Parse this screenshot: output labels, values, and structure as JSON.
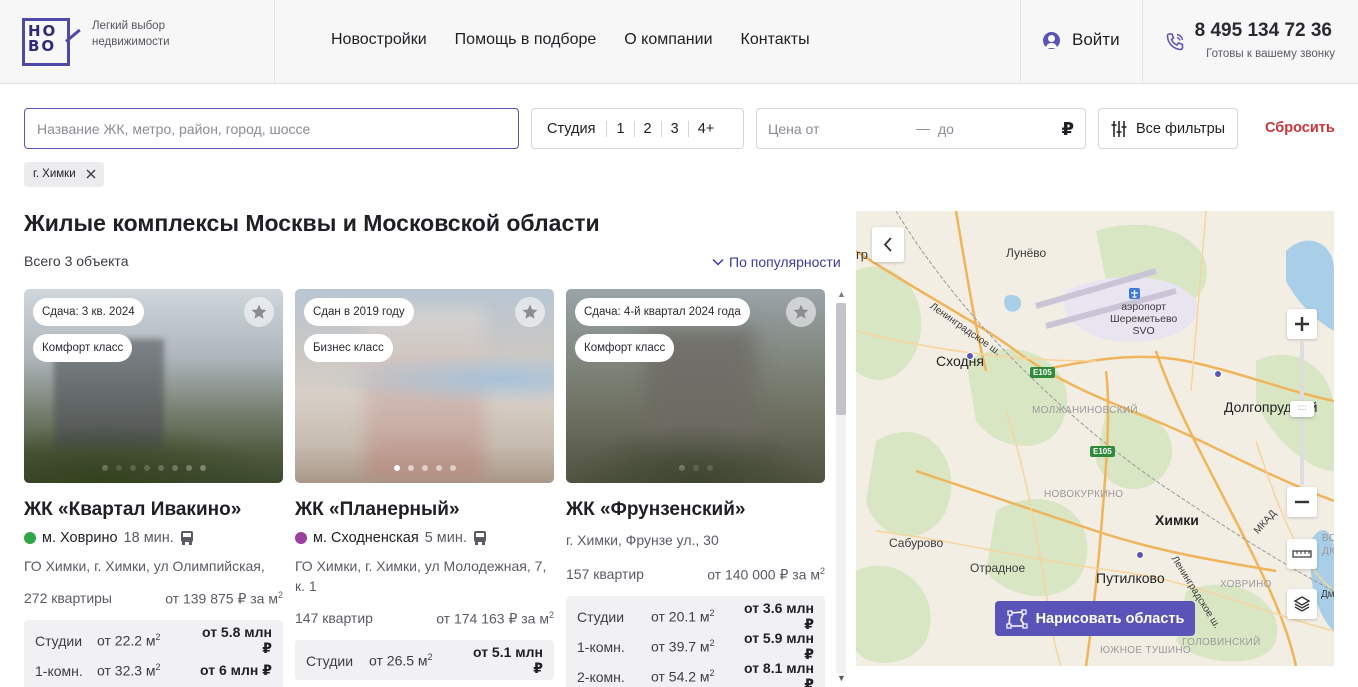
{
  "logo": {
    "text": "HO\nBO"
  },
  "header": {
    "tagline": "Легкий выбор недвижимости",
    "nav": [
      "Новостройки",
      "Помощь в подборе",
      "О компании",
      "Контакты"
    ],
    "login": "Войти",
    "phone": "8 495 134 72 36",
    "phone_note": "Готовы к вашему звонку"
  },
  "filters": {
    "search_placeholder": "Название ЖК, метро, район, город, шоссе",
    "rooms": [
      "Студия",
      "1",
      "2",
      "3",
      "4+"
    ],
    "price_from": "Цена от",
    "price_dash": "—",
    "price_to": "до",
    "currency": "₽",
    "all_filters": "Все фильтры",
    "reset": "Сбросить",
    "chip": "г. Химки"
  },
  "listing": {
    "title": "Жилые комплексы Москвы и Московской области",
    "count": "Всего 3 объекта",
    "sort": "По популярности"
  },
  "cards": [
    {
      "badges": [
        "Сдача: 3 кв. 2024",
        "Комфорт класс"
      ],
      "dots": 8,
      "name": "ЖК «Квартал Ивакино»",
      "metro": "м. Ховрино",
      "metro_color": "#2ea64a",
      "metro_time": "18 мин.",
      "address": "ГО Химки, г. Химки, ул Олимпийская,",
      "flats": "272 квартиры",
      "price_m2": "от 139 875 ₽ за м",
      "rows": [
        {
          "type": "Студии",
          "area": "от 22.2 м",
          "price": "от 5.8 млн ₽"
        },
        {
          "type": "1-комн.",
          "area": "от 32.3 м",
          "price": "от 6 млн ₽"
        }
      ]
    },
    {
      "badges": [
        "Сдан в 2019 году",
        "Бизнес класс"
      ],
      "dots": 5,
      "name": "ЖК «Планерный»",
      "metro": "м. Сходненская",
      "metro_color": "#9a3fa0",
      "metro_time": "5 мин.",
      "address": "ГО Химки, г. Химки, ул Молодежная, 7, к. 1",
      "flats": "147 квартир",
      "price_m2": "от 174 163 ₽ за м",
      "rows": [
        {
          "type": "Студии",
          "area": "от 26.5 м",
          "price": "от 5.1 млн ₽"
        }
      ]
    },
    {
      "badges": [
        "Сдача: 4-й квартал 2024 года",
        "Комфорт класс"
      ],
      "dots": 3,
      "name": "ЖК «Фрунзенский»",
      "address": "г. Химки, Фрунзе ул., 30",
      "flats": "157 квартир",
      "price_m2": "от 140 000 ₽ за м",
      "rows": [
        {
          "type": "Студии",
          "area": "от 20.1 м",
          "price": "от 3.6 млн ₽"
        },
        {
          "type": "1-комн.",
          "area": "от 39.7 м",
          "price": "от 5.9 млн ₽"
        },
        {
          "type": "2-комн.",
          "area": "от 54.2 м",
          "price": "от 8.1 млн ₽"
        }
      ]
    }
  ],
  "sup": "2",
  "map": {
    "labels": {
      "lunevo": "Лунёво",
      "airport": "аэропорт\nШереметьево\nSVO",
      "leningrad1": "Ленинградское ш.",
      "skhodnya": "Сходня",
      "e105a": "E105",
      "molzh": "МОЛЖАНИНОВСКИЙ",
      "dolgo": "Долгопрудный",
      "e105b": "E105",
      "novok": "НОВОКУРКИНО",
      "khimki": "Химки",
      "mkad": "МКАД",
      "saburovo": "Сабурово",
      "otradnoe": "Отрадное",
      "putilkovo": "Путилково",
      "leningrad2": "Ленинградское ш.",
      "khovrino": "ХОВРИНО",
      "golovinsky": "ГОЛОВИНСКИЙ",
      "yuzhnoe": "ЮЖНОЕ ТУШИНО",
      "edge_left": "гр",
      "edge_right": "Дм",
      "edge_vos": "ВОС",
      "edge_dk": "ДК"
    },
    "draw_button": "Нарисовать область"
  }
}
